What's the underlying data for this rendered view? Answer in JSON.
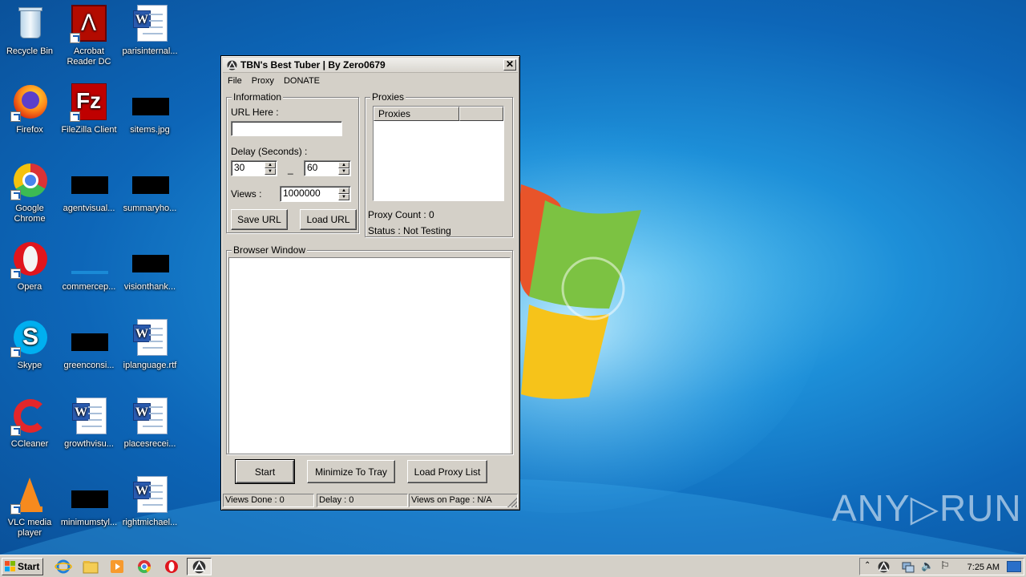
{
  "desktop": {
    "icons": [
      {
        "label": "Recycle Bin"
      },
      {
        "label": "Acrobat Reader DC"
      },
      {
        "label": "parisinternal..."
      },
      {
        "label": "Firefox"
      },
      {
        "label": "FileZilla Client"
      },
      {
        "label": "sitems.jpg"
      },
      {
        "label": "Google Chrome"
      },
      {
        "label": "agentvisual..."
      },
      {
        "label": "summaryho..."
      },
      {
        "label": "Opera"
      },
      {
        "label": "commercep..."
      },
      {
        "label": "visionthank..."
      },
      {
        "label": "Skype"
      },
      {
        "label": "greenconsi..."
      },
      {
        "label": "iplanguage.rtf"
      },
      {
        "label": "CCleaner"
      },
      {
        "label": "growthvisu..."
      },
      {
        "label": "placesrecei..."
      },
      {
        "label": "VLC media player"
      },
      {
        "label": "minimumstyl..."
      },
      {
        "label": "rightmichael..."
      }
    ]
  },
  "window": {
    "title": "TBN's Best Tuber | By Zero0679",
    "close_label": "✕",
    "menu": [
      "File",
      "Proxy",
      "DONATE"
    ],
    "information": {
      "title": "Information",
      "url_label": "URL Here :",
      "url_value": "",
      "delay_label": "Delay (Seconds) :",
      "delay_min": "30",
      "delay_sep": "_",
      "delay_max": "60",
      "views_label": "Views :",
      "views_value": "1000000",
      "save_url": "Save URL",
      "load_url": "Load URL"
    },
    "proxies": {
      "title": "Proxies",
      "columns": [
        "Proxies",
        ""
      ],
      "count_text": "Proxy Count : 0",
      "status_text": "Status : Not Testing"
    },
    "browser": {
      "title": "Browser Window"
    },
    "buttons": {
      "start": "Start",
      "minimize": "Minimize To Tray",
      "load_proxy": "Load Proxy List"
    },
    "status": {
      "views_done": "Views Done : 0",
      "delay": "Delay : 0",
      "views_on_page": "Views on Page : N/A"
    }
  },
  "taskbar": {
    "start_label": "Start",
    "clock": "7:25 AM"
  },
  "watermark": "ANY▷RUN"
}
